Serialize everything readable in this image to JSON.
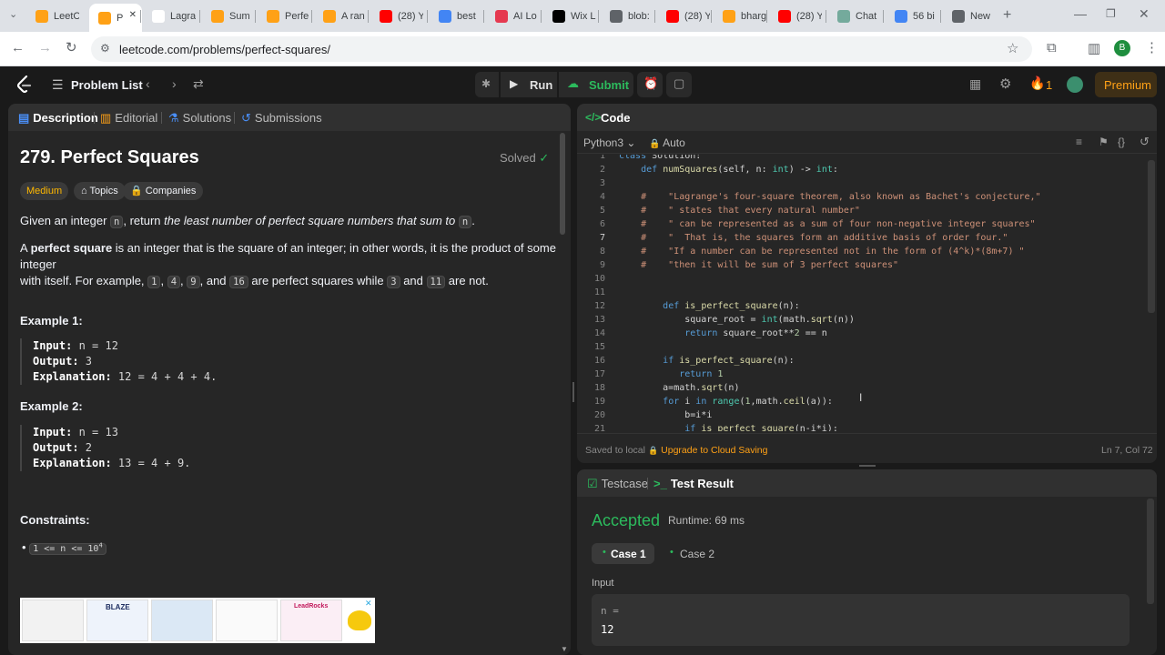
{
  "browser": {
    "tabs": [
      {
        "label": "LeetC",
        "color": "#ffa116"
      },
      {
        "label": "P",
        "color": "#ffa116"
      },
      {
        "label": "Lagra",
        "color": "#ffffff"
      },
      {
        "label": "Sum",
        "color": "#ffa116"
      },
      {
        "label": "Perfe",
        "color": "#ffa116"
      },
      {
        "label": "A ran",
        "color": "#ffa116"
      },
      {
        "label": "(28) Y",
        "color": "#ff0000"
      },
      {
        "label": "best",
        "color": "#4285f4"
      },
      {
        "label": "AI Lo",
        "color": "#e53950"
      },
      {
        "label": "Wix L",
        "color": "#000000"
      },
      {
        "label": "blob:",
        "color": "#5f6368"
      },
      {
        "label": "(28) Y",
        "color": "#ff0000"
      },
      {
        "label": "bharg",
        "color": "#ffa116"
      },
      {
        "label": "(28) Y",
        "color": "#ff0000"
      },
      {
        "label": "Chat",
        "color": "#74aa9c"
      },
      {
        "label": "56 bi",
        "color": "#4285f4"
      },
      {
        "label": "New",
        "color": "#5f6368"
      }
    ],
    "url": "leetcode.com/problems/perfect-squares/",
    "profile_initial": "B"
  },
  "nav": {
    "problem_list": "Problem List",
    "run": "Run",
    "submit": "Submit",
    "streak": "1",
    "premium": "Premium"
  },
  "left_tabs": {
    "description": "Description",
    "editorial": "Editorial",
    "solutions": "Solutions",
    "submissions": "Submissions"
  },
  "problem": {
    "title": "279. Perfect Squares",
    "status": "Solved",
    "difficulty": "Medium",
    "topics": "Topics",
    "companies": "Companies",
    "statement": {
      "p1_a": "Given an integer ",
      "p1_code": "n",
      "p1_b": ", return ",
      "p1_em": "the least number of perfect square numbers that sum to ",
      "p1_code2": "n",
      "p1_c": ".",
      "p2_a": "A ",
      "p2_b": "perfect square",
      "p2_c": " is an integer that is the square of an integer; in other words, it is the product of some integer",
      "p2_d": "with itself. For example, ",
      "c1": "1",
      "c4": "4",
      "c9": "9",
      "c16": "16",
      "and": ", and ",
      "p2_e": " are perfect squares while ",
      "c3": "3",
      "and2": " and ",
      "c11": "11",
      "p2_f": " are not."
    },
    "example1": {
      "heading": "Example 1:",
      "input_label": "Input:",
      "input": " n = 12",
      "output_label": "Output:",
      "output": " 3",
      "expl_label": "Explanation:",
      "expl": " 12 = 4 + 4 + 4."
    },
    "example2": {
      "heading": "Example 2:",
      "input_label": "Input:",
      "input": " n = 13",
      "output_label": "Output:",
      "output": " 2",
      "expl_label": "Explanation:",
      "expl": " 13 = 4 + 9."
    },
    "constraints_heading": "Constraints:",
    "constraint": "1 <= n <= 10",
    "constraint_sup": "4"
  },
  "ad": {
    "blaze": "BLAZE",
    "leadrocks": "LeadRocks"
  },
  "code_panel": {
    "title": "Code",
    "language": "Python3",
    "mode": "Auto",
    "saved": "Saved to local",
    "upgrade": "Upgrade to Cloud Saving",
    "cursor_pos": "Ln 7, Col 72",
    "lines": [
      {
        "n": "1",
        "t": "class Solution:"
      },
      {
        "n": "2",
        "t": "    def numSquares(self, n: int) -> int:"
      },
      {
        "n": "3",
        "t": ""
      },
      {
        "n": "4",
        "t": "    #    \"Lagrange's four-square theorem, also known as Bachet's conjecture,\""
      },
      {
        "n": "5",
        "t": "    #    \" states that every natural number\""
      },
      {
        "n": "6",
        "t": "    #    \" can be represented as a sum of four non-negative integer squares\""
      },
      {
        "n": "7",
        "t": "    #    \"  That is, the squares form an additive basis of order four.\""
      },
      {
        "n": "8",
        "t": "    #    \"If a number can be represented not in the form of (4^k)*(8m+7) \""
      },
      {
        "n": "9",
        "t": "    #    \"then it will be sum of 3 perfect squares\""
      },
      {
        "n": "10",
        "t": ""
      },
      {
        "n": "11",
        "t": ""
      },
      {
        "n": "12",
        "t": "        def is_perfect_square(n):"
      },
      {
        "n": "13",
        "t": "            square_root = int(math.sqrt(n))"
      },
      {
        "n": "14",
        "t": "            return square_root**2 == n"
      },
      {
        "n": "15",
        "t": ""
      },
      {
        "n": "16",
        "t": "        if is_perfect_square(n):"
      },
      {
        "n": "17",
        "t": "           return 1"
      },
      {
        "n": "18",
        "t": "        a=math.sqrt(n)"
      },
      {
        "n": "19",
        "t": "        for i in range(1,math.ceil(a)):"
      },
      {
        "n": "20",
        "t": "            b=i*i"
      },
      {
        "n": "21",
        "t": "            if is_perfect_square(n-i*i):"
      }
    ]
  },
  "result_panel": {
    "testcase": "Testcase",
    "test_result": "Test Result",
    "verdict": "Accepted",
    "runtime": "Runtime: 69 ms",
    "case1": "Case 1",
    "case2": "Case 2",
    "input_label": "Input",
    "var_label": "n =",
    "var_value": "12"
  },
  "colors": {
    "accent_orange": "#ffa116",
    "accent_green": "#2cbb5d",
    "medium": "#ffb800"
  }
}
